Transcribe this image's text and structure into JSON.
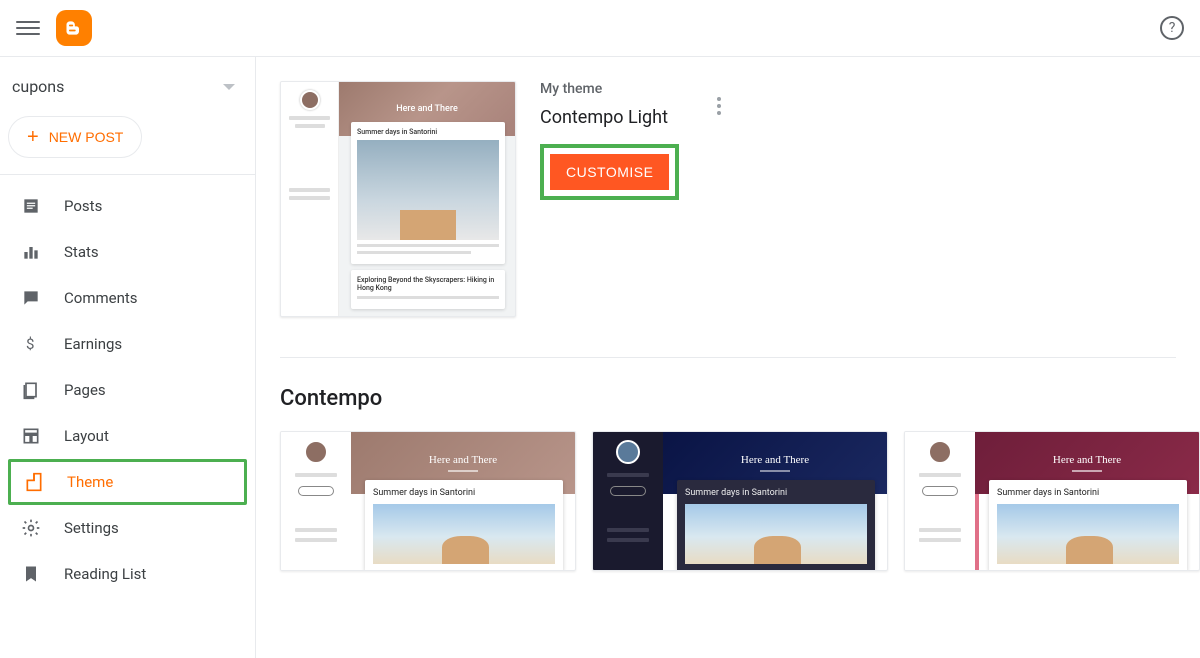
{
  "blog_name": "cupons",
  "new_post_label": "NEW POST",
  "nav": {
    "posts": "Posts",
    "stats": "Stats",
    "comments": "Comments",
    "earnings": "Earnings",
    "pages": "Pages",
    "layout": "Layout",
    "theme": "Theme",
    "settings": "Settings",
    "reading_list": "Reading List"
  },
  "my_theme": {
    "label": "My theme",
    "name": "Contempo Light",
    "customise_label": "CUSTOMISE",
    "preview_header": "Here and There",
    "preview_post1": "Summer days in Santorini",
    "preview_post2": "Exploring Beyond the Skyscrapers: Hiking in Hong Kong"
  },
  "gallery": {
    "section_title": "Contempo",
    "hero_title": "Here and There",
    "post_title": "Summer days in Santorini",
    "variants": [
      "light",
      "dark",
      "wine"
    ]
  }
}
